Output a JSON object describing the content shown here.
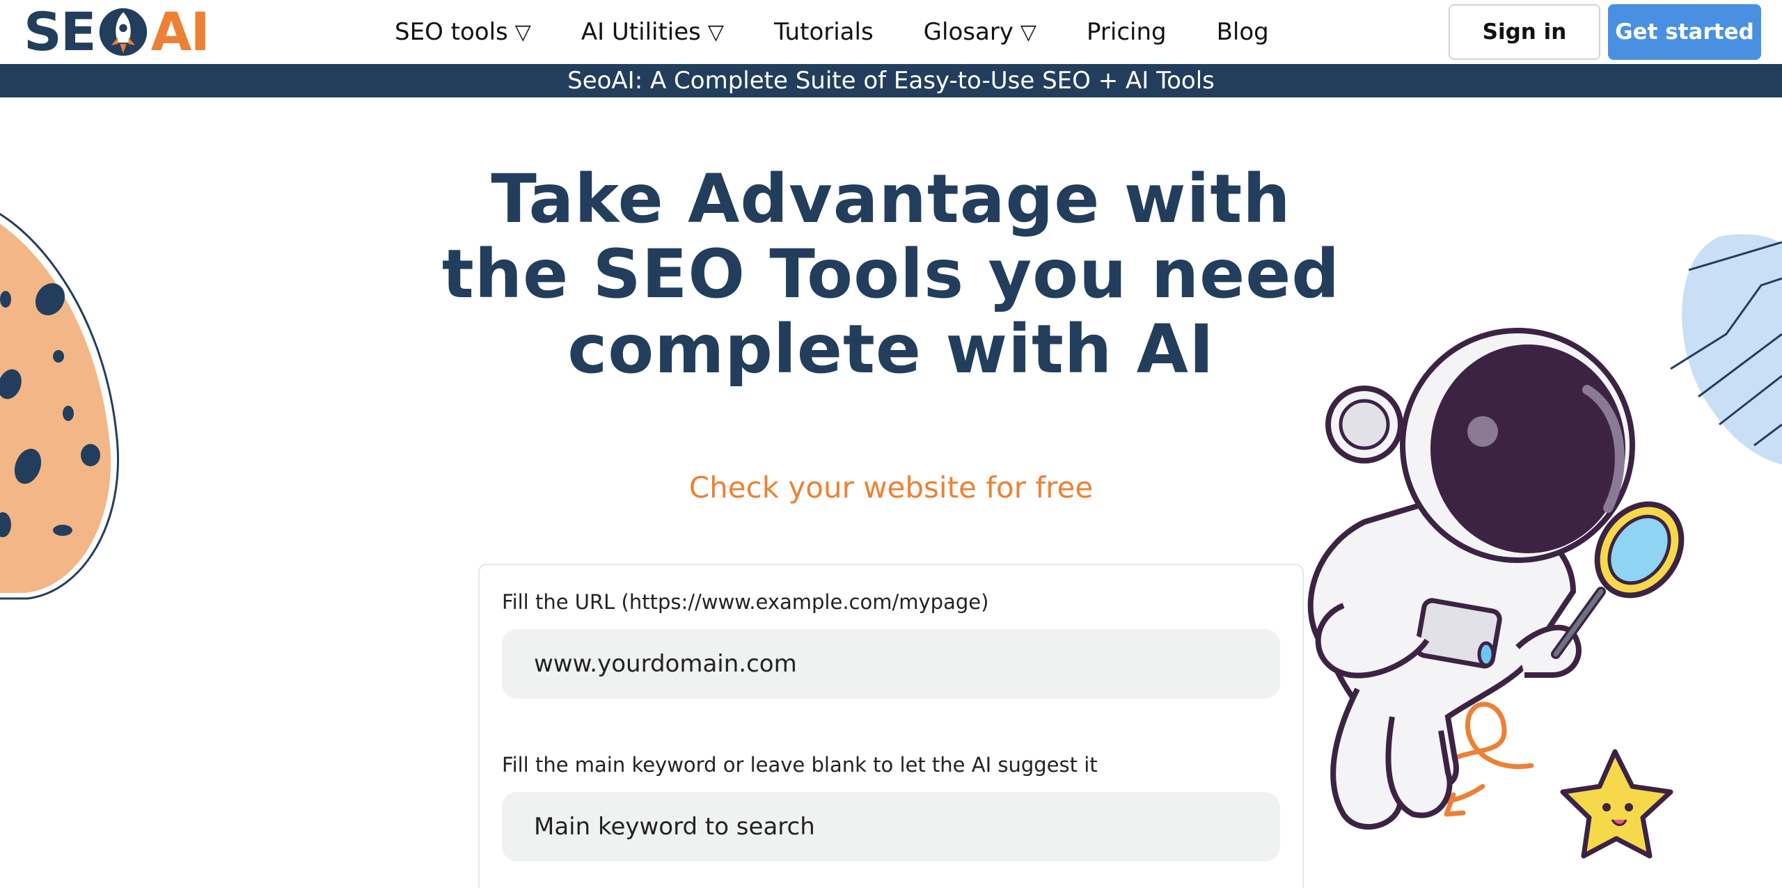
{
  "logo": {
    "left": "SE",
    "right": "AI"
  },
  "nav": {
    "items": [
      {
        "label": "SEO tools",
        "caret": "▽"
      },
      {
        "label": "AI Utilities",
        "caret": "▽"
      },
      {
        "label": "Tutorials"
      },
      {
        "label": "Glosary",
        "caret": "▽"
      },
      {
        "label": "Pricing"
      },
      {
        "label": "Blog"
      }
    ],
    "signin_label": "Sign in",
    "get_started_label": "Get started"
  },
  "banner": {
    "text": "SeoAI: A Complete Suite of Easy-to-Use SEO + AI Tools"
  },
  "hero": {
    "line1": {
      "a": "Take ",
      "b": "Advantage",
      "c": " with"
    },
    "line2": {
      "a": "the ",
      "b": "SEO Tools",
      "c": " you need"
    },
    "line3": {
      "a": "complete ",
      "b": "with AI"
    },
    "cta": "Check your website for free"
  },
  "form": {
    "url_label": "Fill the URL (https://www.example.com/mypage)",
    "url_placeholder": "www.yourdomain.com",
    "keyword_label": "Fill the main keyword or leave blank to let the AI suggest it",
    "keyword_placeholder": "Main keyword to search"
  },
  "colors": {
    "navy": "#223e5c",
    "orange": "#ec8135",
    "blue_button": "#4a90e2",
    "input_bg": "#f0f2f2"
  },
  "icons": {
    "logo_rocket": "rocket-icon",
    "illustration": "astronaut-with-magnifier",
    "star": "star-character-icon"
  }
}
